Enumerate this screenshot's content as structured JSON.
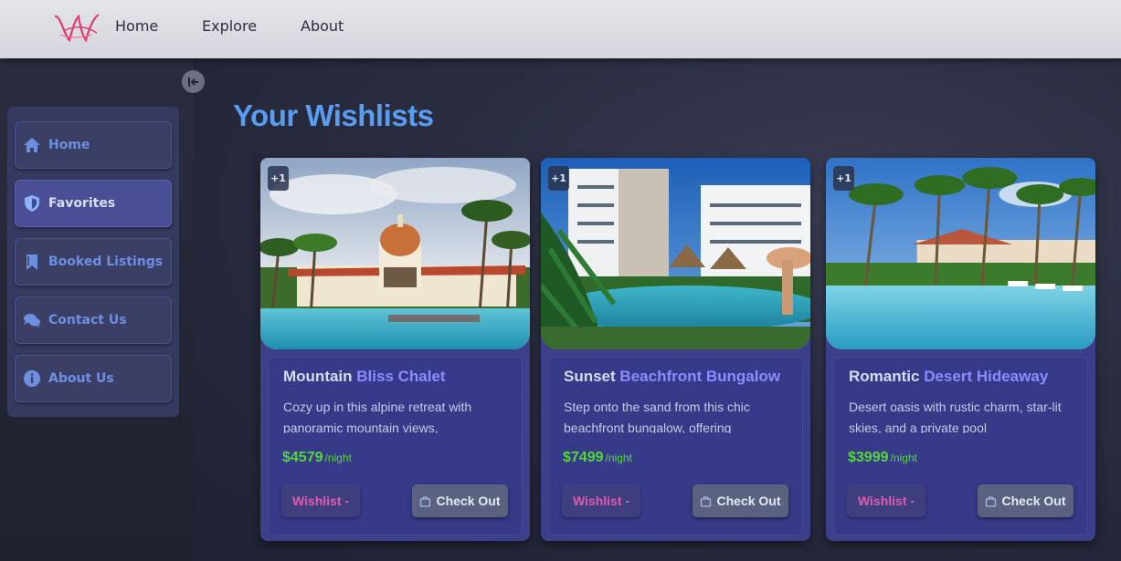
{
  "nav": {
    "links": [
      "Home",
      "Explore",
      "About"
    ]
  },
  "sidebar": {
    "collapse_icon": "arrow-left-to-bar-icon",
    "items": [
      {
        "label": "Home",
        "icon": "home-icon",
        "active": false
      },
      {
        "label": "Favorites",
        "icon": "shield-icon",
        "active": true
      },
      {
        "label": "Booked Listings",
        "icon": "bookmark-icon",
        "active": false
      },
      {
        "label": "Contact Us",
        "icon": "chat-bubbles-icon",
        "active": false
      },
      {
        "label": "About Us",
        "icon": "info-circle-icon",
        "active": false
      }
    ]
  },
  "main": {
    "title": "Your Wishlists",
    "cards": [
      {
        "badge": "+1",
        "title_first": "Mountain",
        "title_rest": "Bliss Chalet",
        "description": "Cozy up in this alpine retreat with panoramic mountain views,",
        "price": "$4579",
        "per_night": "/night",
        "wishlist_label": "Wishlist -",
        "checkout_label": "Check Out"
      },
      {
        "badge": "+1",
        "title_first": "Sunset",
        "title_rest": "Beachfront Bungalow",
        "description": "Step onto the sand from this chic beachfront bungalow, offering",
        "price": "$7499",
        "per_night": "/night",
        "wishlist_label": "Wishlist -",
        "checkout_label": "Check Out"
      },
      {
        "badge": "+1",
        "title_first": "Romantic",
        "title_rest": "Desert Hideaway",
        "description": "Desert oasis with rustic charm, star-lit skies, and a private pool",
        "price": "$3999",
        "per_night": "/night",
        "wishlist_label": "Wishlist -",
        "checkout_label": "Check Out"
      }
    ]
  },
  "colors": {
    "title_blue": "#5a9cf0",
    "price_green": "#55d63c",
    "wishlist_pink": "#e05bb0",
    "card_bg": "#3c3f8a"
  }
}
